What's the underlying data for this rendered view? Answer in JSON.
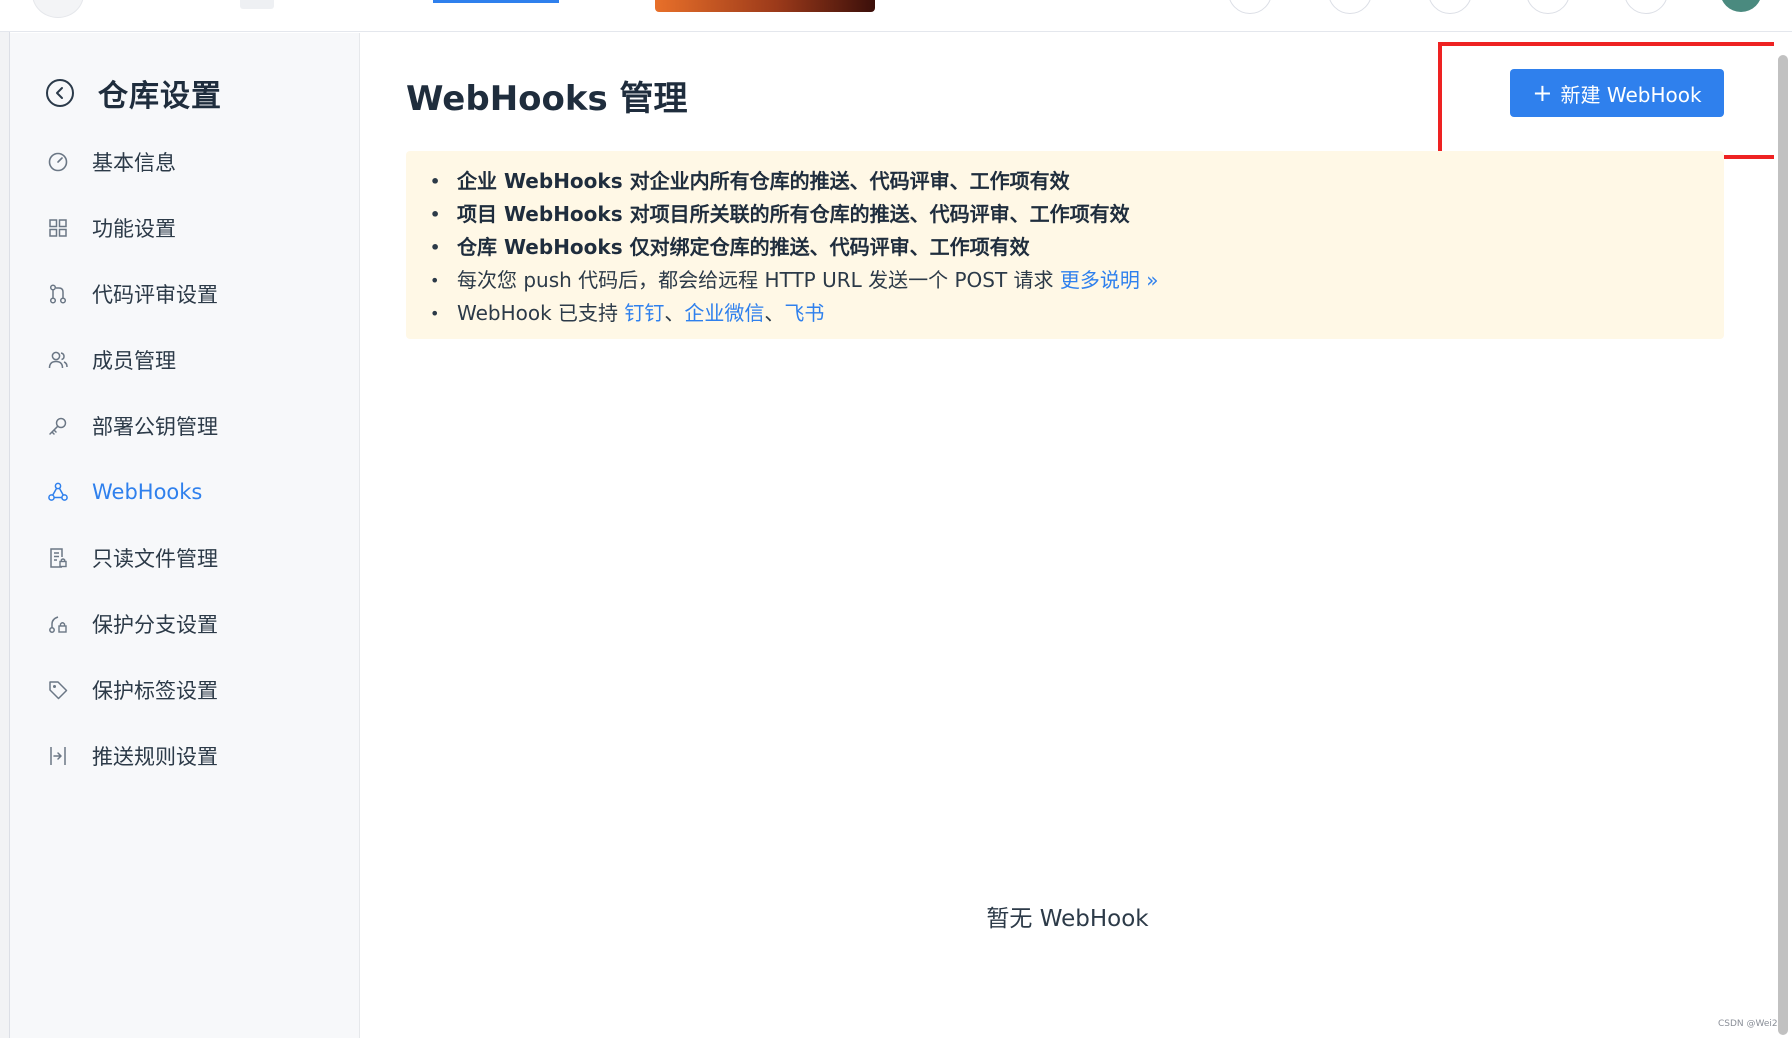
{
  "sidebar": {
    "title": "仓库设置",
    "items": [
      {
        "label": "基本信息",
        "icon": "gauge-icon"
      },
      {
        "label": "功能设置",
        "icon": "grid-icon"
      },
      {
        "label": "代码评审设置",
        "icon": "git-merge-icon"
      },
      {
        "label": "成员管理",
        "icon": "users-icon"
      },
      {
        "label": "部署公钥管理",
        "icon": "key-icon"
      },
      {
        "label": "WebHooks",
        "icon": "webhook-icon",
        "active": true
      },
      {
        "label": "只读文件管理",
        "icon": "file-lock-icon"
      },
      {
        "label": "保护分支设置",
        "icon": "branch-lock-icon"
      },
      {
        "label": "保护标签设置",
        "icon": "tag-icon"
      },
      {
        "label": "推送规则设置",
        "icon": "push-rule-icon"
      }
    ]
  },
  "main": {
    "title": "WebHooks 管理",
    "new_button_label": "新建 WebHook",
    "notice": {
      "line1": "企业 WebHooks 对企业内所有仓库的推送、代码评审、工作项有效",
      "line2": "项目 WebHooks 对项目所关联的所有仓库的推送、代码评审、工作项有效",
      "line3": "仓库 WebHooks 仅对绑定仓库的推送、代码评审、工作项有效",
      "line4_text": "每次您 push 代码后，都会给远程 HTTP URL 发送一个 POST 请求 ",
      "line4_link": "更多说明 »",
      "line5_text": "WebHook 已支持 ",
      "line5_link1": "钉钉",
      "sep1": "、",
      "line5_link2": "企业微信",
      "sep2": "、",
      "line5_link3": "飞书"
    },
    "empty_text": "暂无 WebHook"
  },
  "colors": {
    "accent": "#2f80ed",
    "notice_bg": "#fff8e6",
    "highlight_border": "#ee2222"
  },
  "corner_mark": "CSDN @Wei2"
}
